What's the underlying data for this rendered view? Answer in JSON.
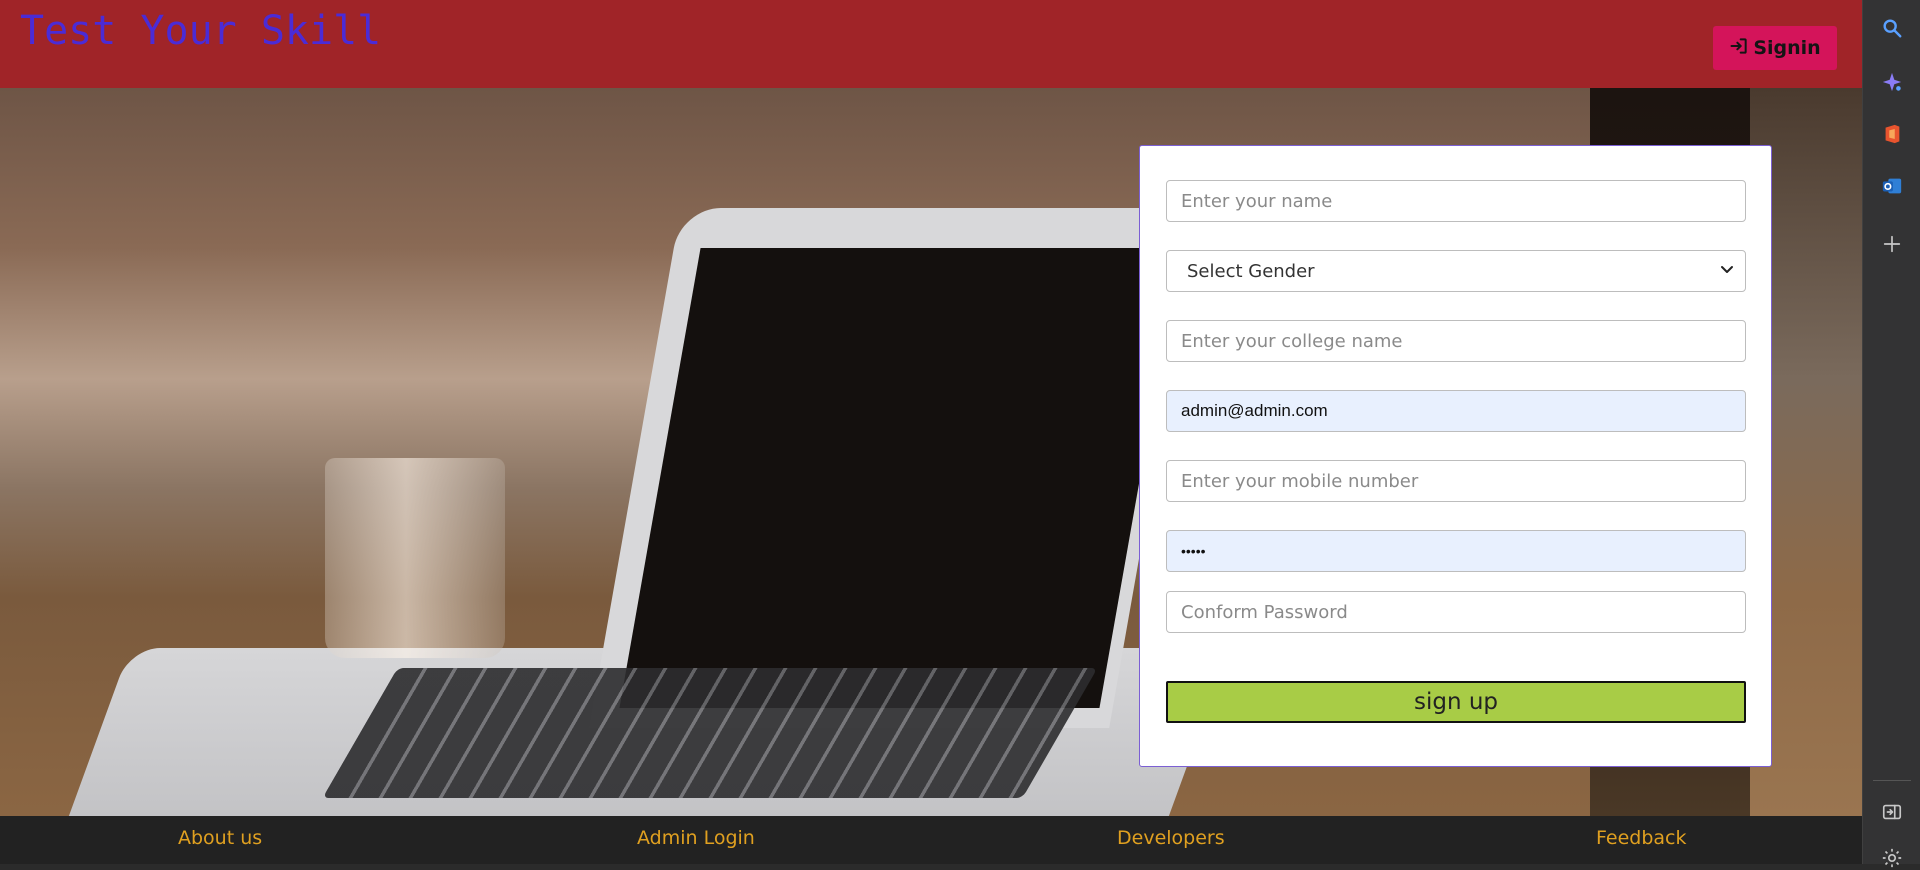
{
  "header": {
    "brand": "Test Your Skill",
    "signin_label": "Signin"
  },
  "form": {
    "name_placeholder": "Enter your name",
    "gender_selected": "Select Gender",
    "college_placeholder": "Enter your college name",
    "email_value": "admin@admin.com",
    "mobile_placeholder": "Enter your mobile number",
    "password_value": "•••••",
    "confirm_placeholder": "Conform Password",
    "submit_label": "sign up"
  },
  "footer": {
    "links": [
      "About us",
      "Admin Login",
      "Developers",
      "Feedback"
    ]
  },
  "sidebar": {
    "icons": [
      "search-icon",
      "copilot-sparkle-icon",
      "office-icon",
      "outlook-icon",
      "add-icon",
      "split-panel-icon",
      "settings-icon"
    ]
  },
  "colors": {
    "header_bg": "#a02428",
    "brand_text": "#4b2bd6",
    "signin_bg": "#d4145a",
    "signup_bg": "#a8cc46",
    "footer_bg": "#222222",
    "footer_link": "#e0a020",
    "autofill_bg": "#e8f0fe"
  }
}
